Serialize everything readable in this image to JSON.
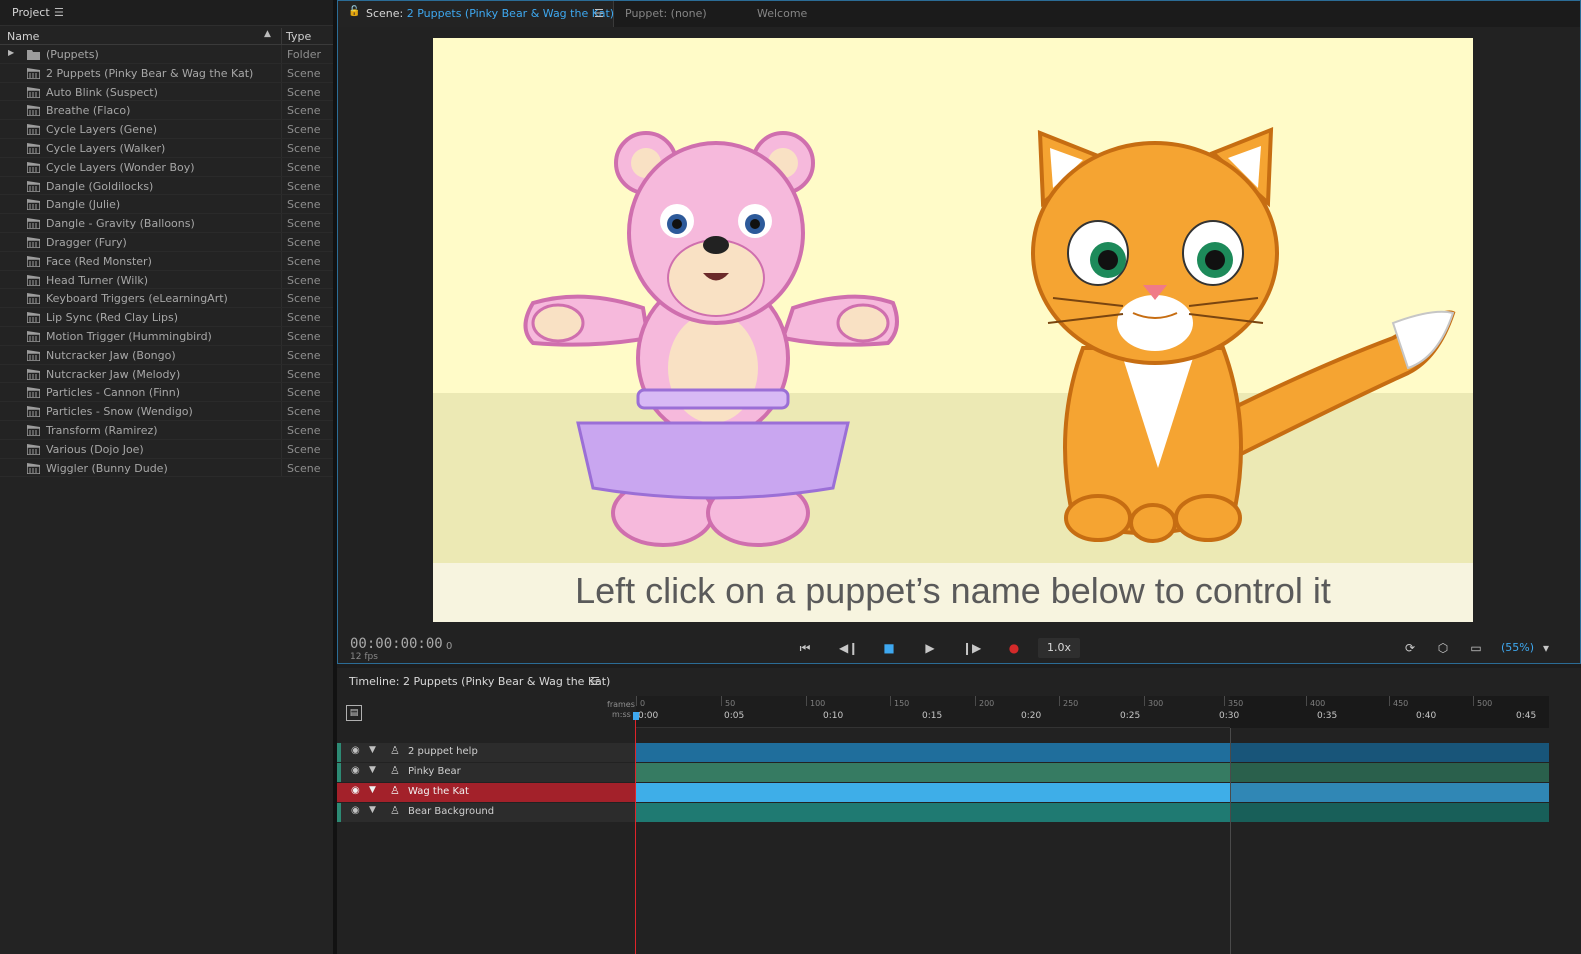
{
  "project": {
    "title": "Project",
    "menu_icon": "hamburger-icon",
    "columns": {
      "name": "Name",
      "type": "Type"
    },
    "items": [
      {
        "name": "(Puppets)",
        "type": "Folder",
        "icon": "folder-icon",
        "expandable": true
      },
      {
        "name": "2 Puppets (Pinky Bear & Wag the Kat)",
        "type": "Scene",
        "icon": "scene-icon"
      },
      {
        "name": "Auto Blink (Suspect)",
        "type": "Scene",
        "icon": "scene-icon"
      },
      {
        "name": "Breathe (Flaco)",
        "type": "Scene",
        "icon": "scene-icon"
      },
      {
        "name": "Cycle Layers (Gene)",
        "type": "Scene",
        "icon": "scene-icon"
      },
      {
        "name": "Cycle Layers (Walker)",
        "type": "Scene",
        "icon": "scene-icon"
      },
      {
        "name": "Cycle Layers (Wonder Boy)",
        "type": "Scene",
        "icon": "scene-icon"
      },
      {
        "name": "Dangle (Goldilocks)",
        "type": "Scene",
        "icon": "scene-icon"
      },
      {
        "name": "Dangle (Julie)",
        "type": "Scene",
        "icon": "scene-icon"
      },
      {
        "name": "Dangle - Gravity (Balloons)",
        "type": "Scene",
        "icon": "scene-icon"
      },
      {
        "name": "Dragger (Fury)",
        "type": "Scene",
        "icon": "scene-icon"
      },
      {
        "name": "Face (Red Monster)",
        "type": "Scene",
        "icon": "scene-icon"
      },
      {
        "name": "Head Turner (Wilk)",
        "type": "Scene",
        "icon": "scene-icon"
      },
      {
        "name": "Keyboard Triggers (eLearningArt)",
        "type": "Scene",
        "icon": "scene-icon"
      },
      {
        "name": "Lip Sync (Red Clay Lips)",
        "type": "Scene",
        "icon": "scene-icon"
      },
      {
        "name": "Motion Trigger (Hummingbird)",
        "type": "Scene",
        "icon": "scene-icon"
      },
      {
        "name": "Nutcracker Jaw (Bongo)",
        "type": "Scene",
        "icon": "scene-icon"
      },
      {
        "name": "Nutcracker Jaw (Melody)",
        "type": "Scene",
        "icon": "scene-icon"
      },
      {
        "name": "Particles - Cannon (Finn)",
        "type": "Scene",
        "icon": "scene-icon"
      },
      {
        "name": "Particles - Snow (Wendigo)",
        "type": "Scene",
        "icon": "scene-icon"
      },
      {
        "name": "Transform (Ramirez)",
        "type": "Scene",
        "icon": "scene-icon"
      },
      {
        "name": "Various (Dojo Joe)",
        "type": "Scene",
        "icon": "scene-icon"
      },
      {
        "name": "Wiggler (Bunny Dude)",
        "type": "Scene",
        "icon": "scene-icon"
      }
    ]
  },
  "scene_panel": {
    "tab_prefix": "Scene:",
    "tab_scene_name": "2 Puppets (Pinky Bear & Wag the Kat)",
    "tab_puppet": "Puppet: (none)",
    "tab_welcome": "Welcome",
    "caption": "Left click on a puppet’s name below to control it",
    "timecode": "00:00:00:00",
    "frame": "0",
    "fps": "12 fps",
    "speed": "1.0x",
    "zoom": "(55%)",
    "accent_color": "#3ea8f0",
    "record_color": "#d42a2a"
  },
  "timeline": {
    "title": "Timeline: 2 Puppets (Pinky Bear & Wag the Kat)",
    "frames_label": "frames",
    "mss_label": "m:ss",
    "frame_ticks": [
      "0",
      "50",
      "100",
      "150",
      "200",
      "250",
      "300",
      "350",
      "400",
      "450",
      "500"
    ],
    "time_ticks": [
      "0:00",
      "0:05",
      "0:10",
      "0:15",
      "0:20",
      "0:25",
      "0:30",
      "0:35",
      "0:40",
      "0:45"
    ],
    "tracks": [
      {
        "name": "2 puppet help",
        "color": "#1f6e9c",
        "selected": false
      },
      {
        "name": "Pinky Bear",
        "color": "#367b62",
        "selected": false
      },
      {
        "name": "Wag the Kat",
        "color": "#3eaee8",
        "selected": true
      },
      {
        "name": "Bear Background",
        "color": "#1f7a72",
        "selected": false
      }
    ]
  }
}
